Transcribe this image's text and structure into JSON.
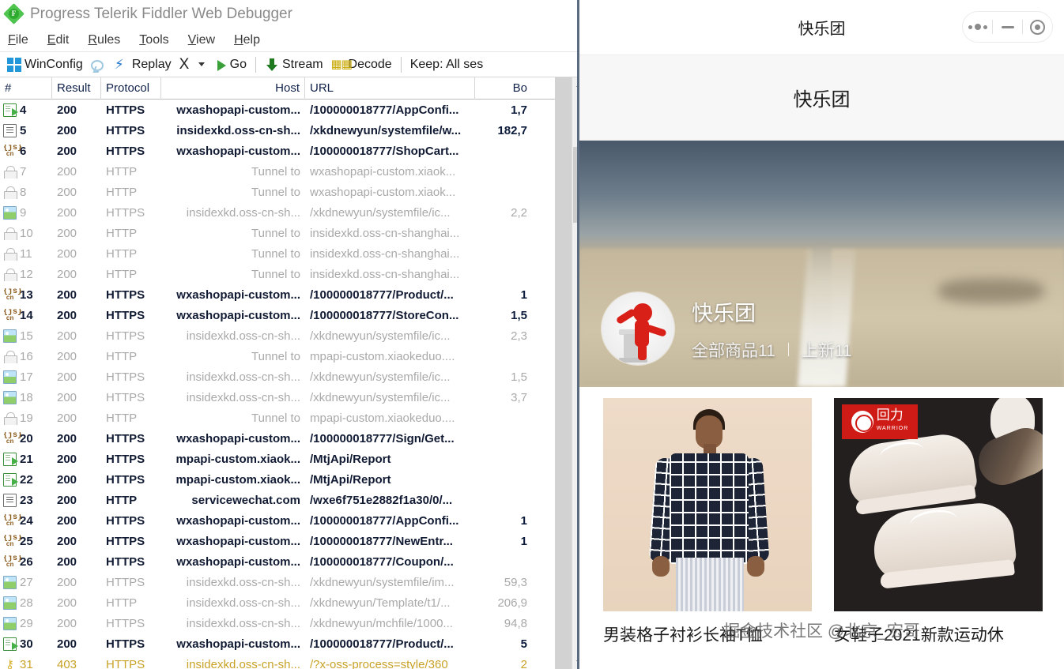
{
  "fiddler": {
    "window_title": "Progress Telerik Fiddler Web Debugger",
    "logo_letter": "F",
    "menus": [
      {
        "pre": "F",
        "rest": "ile"
      },
      {
        "pre": "E",
        "rest": "dit"
      },
      {
        "pre": "R",
        "rest": "ules"
      },
      {
        "pre": "T",
        "rest": "ools"
      },
      {
        "pre": "V",
        "rest": "iew"
      },
      {
        "pre": "H",
        "rest": "elp"
      }
    ],
    "toolbar": {
      "winconfig": "WinConfig",
      "replay": "Replay",
      "remove": "X",
      "go": "Go",
      "stream": "Stream",
      "decode": "Decode",
      "keep": "Keep: All ses"
    },
    "grid": {
      "columns": [
        "#",
        "Result",
        "Protocol",
        "Host",
        "URL",
        "Bo"
      ],
      "rows": [
        {
          "icon": "doc-arrow",
          "num": "4",
          "result": "200",
          "protocol": "HTTPS",
          "host": "wxashopapi-custom...",
          "url": "/100000018777/AppConfi...",
          "body": "1,7",
          "tone": "dark"
        },
        {
          "icon": "doc-plain",
          "num": "5",
          "result": "200",
          "protocol": "HTTPS",
          "host": "insidexkd.oss-cn-sh...",
          "url": "/xkdnewyun/systemfile/w...",
          "body": "182,7",
          "tone": "dark"
        },
        {
          "icon": "json",
          "num": "6",
          "result": "200",
          "protocol": "HTTPS",
          "host": "wxashopapi-custom...",
          "url": "/100000018777/ShopCart...",
          "body": "",
          "tone": "dark"
        },
        {
          "icon": "lock",
          "num": "7",
          "result": "200",
          "protocol": "HTTP",
          "host": "Tunnel to",
          "url": "wxashopapi-custom.xiaok...",
          "body": "",
          "tone": "gray"
        },
        {
          "icon": "lock",
          "num": "8",
          "result": "200",
          "protocol": "HTTP",
          "host": "Tunnel to",
          "url": "wxashopapi-custom.xiaok...",
          "body": "",
          "tone": "gray"
        },
        {
          "icon": "image",
          "num": "9",
          "result": "200",
          "protocol": "HTTPS",
          "host": "insidexkd.oss-cn-sh...",
          "url": "/xkdnewyun/systemfile/ic...",
          "body": "2,2",
          "tone": "gray"
        },
        {
          "icon": "lock",
          "num": "10",
          "result": "200",
          "protocol": "HTTP",
          "host": "Tunnel to",
          "url": "insidexkd.oss-cn-shanghai...",
          "body": "",
          "tone": "gray"
        },
        {
          "icon": "lock",
          "num": "11",
          "result": "200",
          "protocol": "HTTP",
          "host": "Tunnel to",
          "url": "insidexkd.oss-cn-shanghai...",
          "body": "",
          "tone": "gray"
        },
        {
          "icon": "lock",
          "num": "12",
          "result": "200",
          "protocol": "HTTP",
          "host": "Tunnel to",
          "url": "insidexkd.oss-cn-shanghai...",
          "body": "",
          "tone": "gray"
        },
        {
          "icon": "json",
          "num": "13",
          "result": "200",
          "protocol": "HTTPS",
          "host": "wxashopapi-custom...",
          "url": "/100000018777/Product/...",
          "body": "1",
          "tone": "dark"
        },
        {
          "icon": "json",
          "num": "14",
          "result": "200",
          "protocol": "HTTPS",
          "host": "wxashopapi-custom...",
          "url": "/100000018777/StoreCon...",
          "body": "1,5",
          "tone": "dark"
        },
        {
          "icon": "image",
          "num": "15",
          "result": "200",
          "protocol": "HTTPS",
          "host": "insidexkd.oss-cn-sh...",
          "url": "/xkdnewyun/systemfile/ic...",
          "body": "2,3",
          "tone": "gray"
        },
        {
          "icon": "lock",
          "num": "16",
          "result": "200",
          "protocol": "HTTP",
          "host": "Tunnel to",
          "url": "mpapi-custom.xiaokeduo....",
          "body": "",
          "tone": "gray"
        },
        {
          "icon": "image",
          "num": "17",
          "result": "200",
          "protocol": "HTTPS",
          "host": "insidexkd.oss-cn-sh...",
          "url": "/xkdnewyun/systemfile/ic...",
          "body": "1,5",
          "tone": "gray"
        },
        {
          "icon": "image",
          "num": "18",
          "result": "200",
          "protocol": "HTTPS",
          "host": "insidexkd.oss-cn-sh...",
          "url": "/xkdnewyun/systemfile/ic...",
          "body": "3,7",
          "tone": "gray"
        },
        {
          "icon": "lock",
          "num": "19",
          "result": "200",
          "protocol": "HTTP",
          "host": "Tunnel to",
          "url": "mpapi-custom.xiaokeduo....",
          "body": "",
          "tone": "gray"
        },
        {
          "icon": "json",
          "num": "20",
          "result": "200",
          "protocol": "HTTPS",
          "host": "wxashopapi-custom...",
          "url": "/100000018777/Sign/Get...",
          "body": "",
          "tone": "dark"
        },
        {
          "icon": "doc-arrow",
          "num": "21",
          "result": "200",
          "protocol": "HTTPS",
          "host": "mpapi-custom.xiaok...",
          "url": "/MtjApi/Report",
          "body": "",
          "tone": "dark"
        },
        {
          "icon": "doc-arrow",
          "num": "22",
          "result": "200",
          "protocol": "HTTPS",
          "host": "mpapi-custom.xiaok...",
          "url": "/MtjApi/Report",
          "body": "",
          "tone": "dark"
        },
        {
          "icon": "doc-plain",
          "num": "23",
          "result": "200",
          "protocol": "HTTP",
          "host": "servicewechat.com",
          "url": "/wxe6f751e2882f1a30/0/...",
          "body": "",
          "tone": "dark"
        },
        {
          "icon": "json",
          "num": "24",
          "result": "200",
          "protocol": "HTTPS",
          "host": "wxashopapi-custom...",
          "url": "/100000018777/AppConfi...",
          "body": "1",
          "tone": "dark"
        },
        {
          "icon": "json",
          "num": "25",
          "result": "200",
          "protocol": "HTTPS",
          "host": "wxashopapi-custom...",
          "url": "/100000018777/NewEntr...",
          "body": "1",
          "tone": "dark"
        },
        {
          "icon": "json",
          "num": "26",
          "result": "200",
          "protocol": "HTTPS",
          "host": "wxashopapi-custom...",
          "url": "/100000018777/Coupon/...",
          "body": "",
          "tone": "dark"
        },
        {
          "icon": "image",
          "num": "27",
          "result": "200",
          "protocol": "HTTPS",
          "host": "insidexkd.oss-cn-sh...",
          "url": "/xkdnewyun/systemfile/im...",
          "body": "59,3",
          "tone": "gray"
        },
        {
          "icon": "image",
          "num": "28",
          "result": "200",
          "protocol": "HTTP",
          "host": "insidexkd.oss-cn-sh...",
          "url": "/xkdnewyun/Template/t1/...",
          "body": "206,9",
          "tone": "gray"
        },
        {
          "icon": "image",
          "num": "29",
          "result": "200",
          "protocol": "HTTPS",
          "host": "insidexkd.oss-cn-sh...",
          "url": "/xkdnewyun/mchfile/1000...",
          "body": "94,8",
          "tone": "gray"
        },
        {
          "icon": "doc-arrow",
          "num": "30",
          "result": "200",
          "protocol": "HTTPS",
          "host": "wxashopapi-custom...",
          "url": "/100000018777/Product/...",
          "body": "5",
          "tone": "dark"
        },
        {
          "icon": "keyicon",
          "num": "31",
          "result": "403",
          "protocol": "HTTPS",
          "host": "insidexkd.oss-cn-sh...",
          "url": "/?x-oss-process=style/360",
          "body": "2",
          "tone": "key"
        }
      ]
    }
  },
  "wechat": {
    "nav_title": "快乐团",
    "page_heading": "快乐团",
    "capsule": {
      "more_label": "more-dots",
      "minimize_label": "minimize",
      "close_label": "close-target"
    },
    "store": {
      "name": "快乐团",
      "all_goods": "全部商品11",
      "new_goods": "上新11"
    },
    "products": [
      {
        "title": "男装格子衬衫长袖T恤",
        "image": "mens-plaid-shirt"
      },
      {
        "title": "女鞋子2021新款运动休",
        "image": "womens-sneakers",
        "brand_cn": "回力",
        "brand_en": "WARRIOR"
      }
    ],
    "watermark": "掘金技术社区 @北京_宏哥"
  }
}
